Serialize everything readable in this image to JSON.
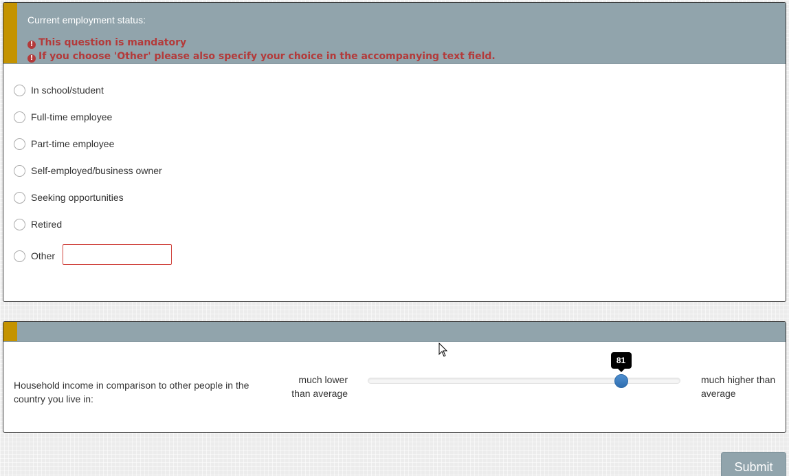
{
  "question1": {
    "title": "Current employment status:",
    "errors": [
      "This question is mandatory",
      "If you choose 'Other' please also specify your choice in the accompanying text field."
    ],
    "options": [
      "In school/student",
      "Full-time employee",
      "Part-time employee",
      "Self-employed/business owner",
      "Seeking opportunities",
      "Retired",
      "Other"
    ],
    "other_value": ""
  },
  "question2": {
    "label": "Household income in comparison to other people in the country you live in:",
    "left_label": "much lower than average",
    "right_label": "much higher than average",
    "slider": {
      "value": 81,
      "min": 0,
      "max": 100
    }
  },
  "submit_label": "Submit",
  "colors": {
    "header": "#91a4ac",
    "accent": "#c49300",
    "error": "#b33a3a",
    "slider_handle": "#3a7cc0"
  },
  "icons": {
    "error": "exclamation-circle-icon",
    "cursor": "mouse-pointer-icon"
  }
}
